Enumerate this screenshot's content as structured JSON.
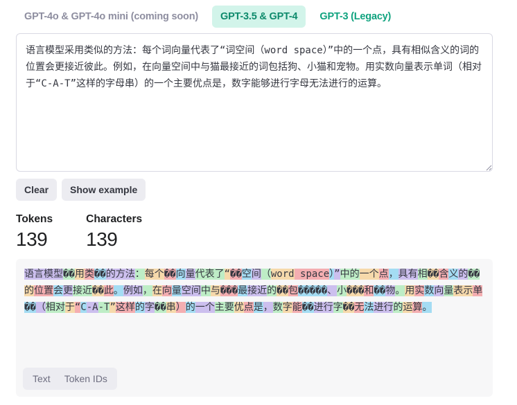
{
  "tabs": [
    {
      "label": "GPT-4o & GPT-4o mini (coming soon)",
      "state": "disabled"
    },
    {
      "label": "GPT-3.5 & GPT-4",
      "state": "active"
    },
    {
      "label": "GPT-3 (Legacy)",
      "state": "normal"
    }
  ],
  "input": {
    "value": "语言模型采用类似的方法：每个词向量代表了“词空间（word space）”中的一个点，具有相似含义的词的位置会更接近彼此。例如，在向量空间中与猫最接近的词包括狗、小猫和宠物。用实数向量表示单词（相对于“C-A-T”这样的字母串）的一个主要优点是，数字能够进行字母无法进行的运算。"
  },
  "buttons": {
    "clear": "Clear",
    "show_example": "Show example"
  },
  "stats": {
    "tokens_label": "Tokens",
    "tokens_value": "139",
    "characters_label": "Characters",
    "characters_value": "139"
  },
  "output_tokens": [
    "语言模型",
    "��",
    "用",
    "类",
    "��",
    "的方法",
    "：",
    "每个",
    "��",
    "向",
    "量",
    "代表了",
    "“",
    "��",
    "空",
    "间",
    "（",
    "word",
    " space",
    "）",
    "”",
    "中的",
    "一个",
    "点",
    "，",
    "具有",
    "相",
    "��",
    "含",
    "义",
    "的",
    "��",
    "的",
    "位置",
    "会",
    "更",
    "接近",
    "��",
    "此",
    "。",
    "例如",
    "，",
    "在",
    "向",
    "量",
    "空间",
    "中",
    "与",
    "���",
    "最",
    "接近",
    "的",
    "��",
    "包",
    "�����",
    "、",
    "小",
    "���",
    "和",
    "��",
    "物",
    "。",
    "用",
    "实",
    "数",
    "向",
    "量",
    "表示",
    "单",
    "��",
    "（",
    "相对",
    "于",
    "“",
    "C",
    "-A",
    "-T",
    "”",
    "这样",
    "的",
    "字",
    "��",
    "串",
    "）",
    "的",
    "一个",
    "主要",
    "优",
    "点",
    "是",
    "，",
    "数",
    "字",
    "能",
    "��",
    "进行",
    "字",
    "��",
    "无",
    "法",
    "进行",
    "的",
    "运",
    "算",
    "。"
  ],
  "view_toggle": {
    "text": "Text",
    "token_ids": "Token IDs"
  },
  "colors": {
    "accent": "#10a37f",
    "active_tab_bg": "#d2f4ea",
    "token_palette": [
      "#6b40d84d",
      "#68de7a66",
      "#f4ac3666",
      "#ef414666",
      "#27b5ea66"
    ]
  }
}
